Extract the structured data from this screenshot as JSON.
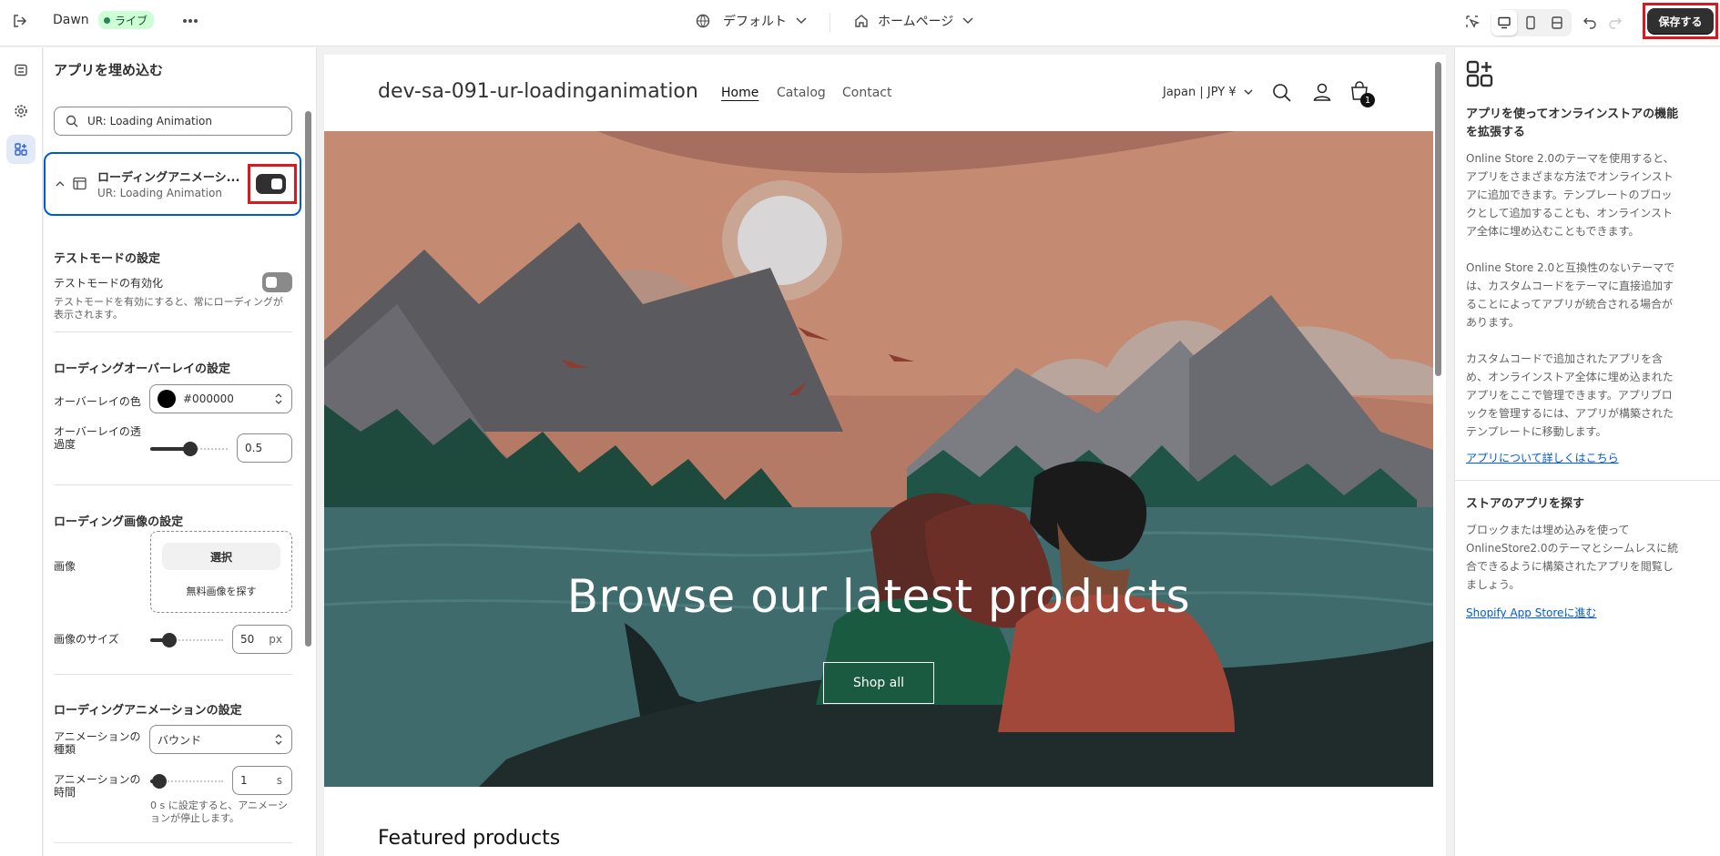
{
  "topbar": {
    "theme_name": "Dawn",
    "live_badge": "ライブ",
    "template_selector": "デフォルト",
    "page_selector": "ホームページ",
    "save_label": "保存する"
  },
  "left_panel": {
    "title": "アプリを埋め込む",
    "search_value": "UR: Loading Animation",
    "app_embed": {
      "title": "ローディングアニメーシ...",
      "subtitle": "UR: Loading Animation",
      "enabled": true
    },
    "test_mode": {
      "heading": "テストモードの設定",
      "label": "テストモードの有効化",
      "help": "テストモードを有効にすると、常にローディングが表示されます。",
      "help_line1": "テストモードを有効にすると、常にローディングが",
      "help_line2": "表示されます。",
      "enabled": false
    },
    "overlay": {
      "heading": "ローディングオーバーレイの設定",
      "color_label": "オーバーレイの色",
      "color_value": "#000000",
      "opacity_label_line1": "オーバーレイの透",
      "opacity_label_line2": "過度",
      "opacity_value": "0.5"
    },
    "image": {
      "heading": "ローディング画像の設定",
      "label": "画像",
      "select_label": "選択",
      "free_images_label": "無料画像を探す",
      "size_label": "画像のサイズ",
      "size_value": "50",
      "size_unit": "px"
    },
    "animation": {
      "heading": "ローディングアニメーションの設定",
      "type_label_line1": "アニメーションの",
      "type_label_line2": "種類",
      "type_value": "バウンド",
      "duration_label_line1": "アニメーションの",
      "duration_label_line2": "時間",
      "duration_value": "1",
      "duration_unit": "s",
      "duration_help_line1": "0 s に設定すると、アニメーシ",
      "duration_help_line2": "ョンが停止します。"
    }
  },
  "preview": {
    "store_name": "dev-sa-091-ur-loadinganimation",
    "nav": [
      "Home",
      "Catalog",
      "Contact"
    ],
    "currency": "Japan | JPY ¥",
    "cart_count": "1",
    "hero_title": "Browse our latest products",
    "hero_button": "Shop all",
    "featured_heading": "Featured products"
  },
  "right_panel": {
    "heading_line1": "アプリを使ってオンラインストアの機能",
    "heading_line2": "を拡張する",
    "para1": [
      "Online Store 2.0のテーマを使用すると、",
      "アプリをさまざまな方法でオンラインスト",
      "アに追加できます。テンプレートのブロッ",
      "クとして追加することも、オンラインスト",
      "ア全体に埋め込むこともできます。"
    ],
    "para2": [
      "Online Store 2.0と互換性のないテーマで",
      "は、カスタムコードをテーマに直接追加す",
      "ることによってアプリが統合される場合が",
      "あります。"
    ],
    "para3": [
      "カスタムコードで追加されたアプリを含",
      "め、オンラインストア全体に埋め込まれた",
      "アプリをここで管理できます。アプリブロ",
      "ックを管理するには、アプリが構築された",
      "テンプレートに移動します。"
    ],
    "learn_more_link": "アプリについて詳しくはこちら",
    "explore_heading": "ストアのアプリを探す",
    "explore_para": [
      "ブロックまたは埋め込みを使って",
      "OnlineStore2.0のテーマとシームレスに統",
      "合できるように構築されたアプリを閲覧し",
      "ましょう。"
    ],
    "app_store_link": "Shopify App Storeに進む"
  },
  "colors": {
    "accent": "#005bd3",
    "save_button": "#303030",
    "highlight": "#d81a20",
    "live_badge_bg": "#cdfed4"
  }
}
